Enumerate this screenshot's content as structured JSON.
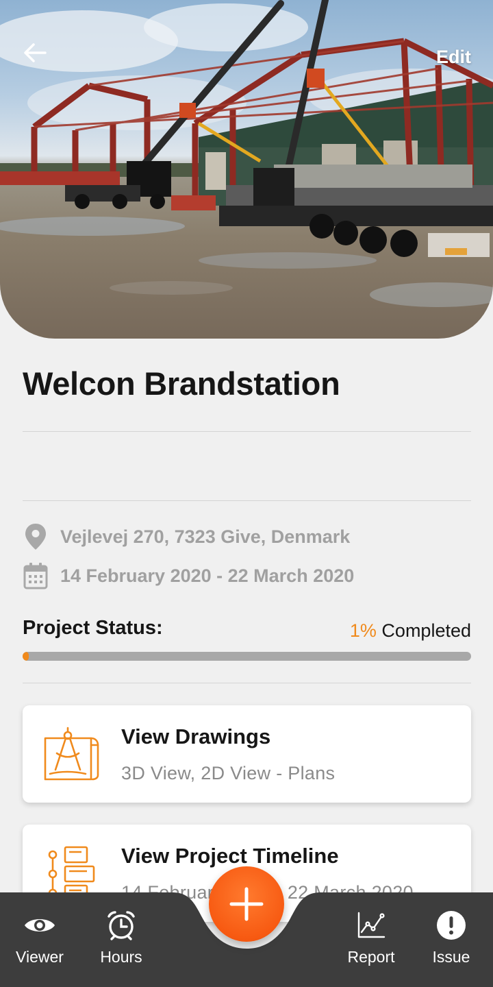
{
  "header": {
    "back_icon": "arrow-left-icon",
    "edit_label": "Edit",
    "photo_alt": "Construction site photo"
  },
  "project": {
    "title": "Welcon Brandstation",
    "address": "Vejlevej 270, 7323 Give, Denmark",
    "dates": "14 February 2020 - 22 March 2020",
    "status_label": "Project Status:",
    "progress_percent_text": "1%",
    "progress_suffix": " Completed",
    "progress_value": 0.01
  },
  "cards": [
    {
      "title": "View Drawings",
      "subtitle": "3D View, 2D View - Plans",
      "icon": "blueprint-compass-icon"
    },
    {
      "title": "View Project Timeline",
      "subtitle": "14 February 2020 - 22 March 2020",
      "icon": "timeline-list-icon"
    }
  ],
  "nav": {
    "items": [
      {
        "label": "Viewer",
        "icon": "eye-icon"
      },
      {
        "label": "Hours",
        "icon": "alarm-clock-icon"
      },
      {
        "label": "Report",
        "icon": "line-chart-icon"
      },
      {
        "label": "Issue",
        "icon": "exclamation-circle-icon"
      }
    ],
    "fab_icon": "plus-icon"
  },
  "colors": {
    "accent": "#f08a1c",
    "fab": "#f75a12",
    "nav_bg": "#3d3d3d",
    "background": "#f0f0f0",
    "muted_text": "#a0a0a0"
  }
}
